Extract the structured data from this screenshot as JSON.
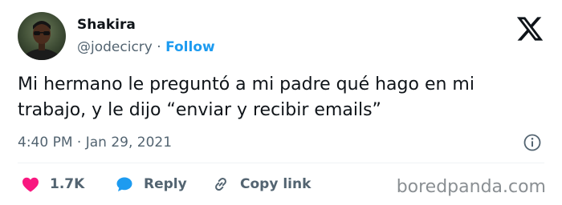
{
  "author": {
    "name": "Shakira",
    "handle": "@jodecicry",
    "separator": "·",
    "follow_label": "Follow"
  },
  "logo_icon": "x-logo-icon",
  "tweet": {
    "text": "Mi hermano le preguntó a mi padre qué hago en mi\ntrabajo, y le dijo “enviar y recibir emails”",
    "timestamp": "4:40 PM · Jan 29, 2021"
  },
  "actions": {
    "like_count": "1.7K",
    "reply_label": "Reply",
    "copy_link_label": "Copy link"
  },
  "icons": [
    "heart-icon",
    "reply-bubble-icon",
    "link-icon",
    "info-icon"
  ],
  "colors": {
    "accent": "#1d9bf0",
    "like": "#f91880",
    "text": "#0f1419",
    "muted": "#536471",
    "watermark": "#8a8f93"
  },
  "watermark": "boredpanda.com"
}
